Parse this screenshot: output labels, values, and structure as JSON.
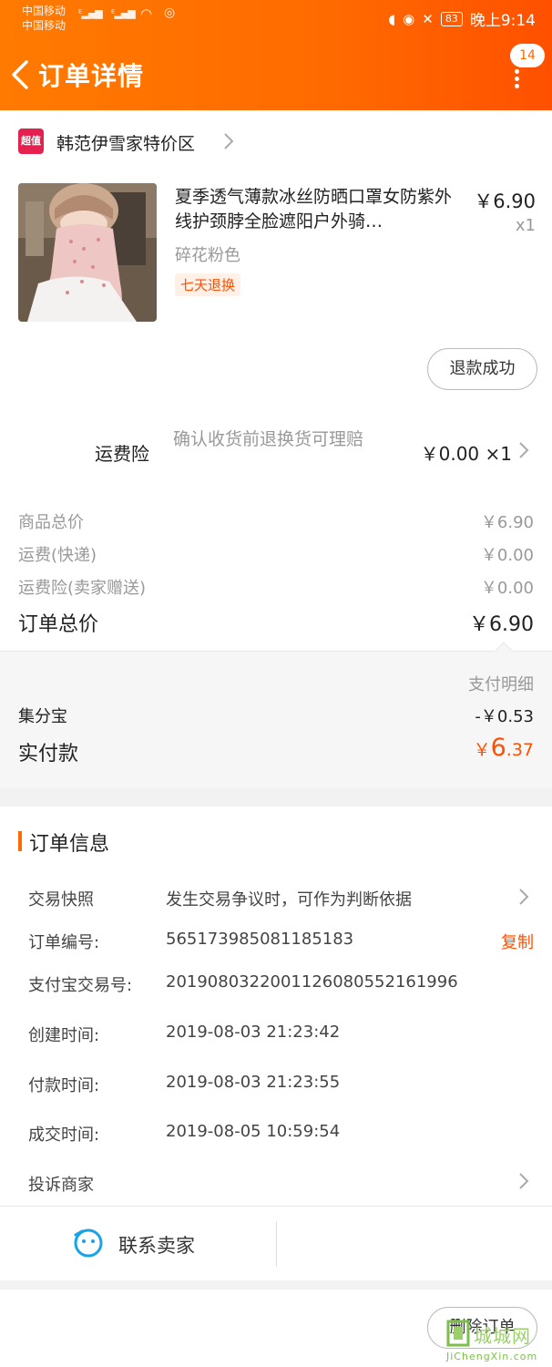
{
  "status_bar": {
    "carrier1": "中国移动",
    "carrier2": "中国移动",
    "battery": "83",
    "time": "晚上9:14"
  },
  "header": {
    "title": "订单详情",
    "badge_count": "14",
    "color": "#ff6a00"
  },
  "shop": {
    "logo_text": "超值",
    "name": "韩范伊雪家特价区"
  },
  "product": {
    "name": "夏季透气薄款冰丝防晒口罩女防紫外线护颈脖全脸遮阳户外骑…",
    "price": "￥6.90",
    "qty": "x1",
    "spec": "碎花粉色",
    "tag": "七天退换",
    "refund_status": "退款成功"
  },
  "insurance": {
    "label": "运费险",
    "desc": "确认收货前退换货可理赔",
    "price": "￥0.00 ×1"
  },
  "totals": {
    "goods_label": "商品总价",
    "goods_value": "￥6.90",
    "shipping_label": "运费(快递)",
    "shipping_value": "￥0.00",
    "ins_label": "运费险(卖家赠送)",
    "ins_value": "￥0.00",
    "order_total_label": "订单总价",
    "order_total_value": "￥6.90"
  },
  "payment": {
    "detail_label": "支付明细",
    "jifenbao_label": "集分宝",
    "jifenbao_value": "-￥0.53",
    "paid_label": "实付款",
    "paid_currency": "￥",
    "paid_int": "6",
    "paid_dec": ".37"
  },
  "order_info": {
    "title": "订单信息",
    "snapshot_label": "交易快照",
    "snapshot_value": "发生交易争议时，可作为判断依据",
    "order_no_label": "订单编号:",
    "order_no_value": "565173985081185183",
    "copy_label": "复制",
    "alipay_label": "支付宝交易号:",
    "alipay_value": "2019080322001126080552161996",
    "created_label": "创建时间:",
    "created_value": "2019-08-03 21:23:42",
    "paid_time_label": "付款时间:",
    "paid_time_value": "2019-08-03 21:23:55",
    "deal_label": "成交时间:",
    "deal_value": "2019-08-05 10:59:54",
    "complain_label": "投诉商家"
  },
  "actions": {
    "contact_seller": "联系卖家",
    "delete_order": "删除订单"
  },
  "watermark": {
    "text": "城城网",
    "sub": "JiChengXin.com"
  }
}
